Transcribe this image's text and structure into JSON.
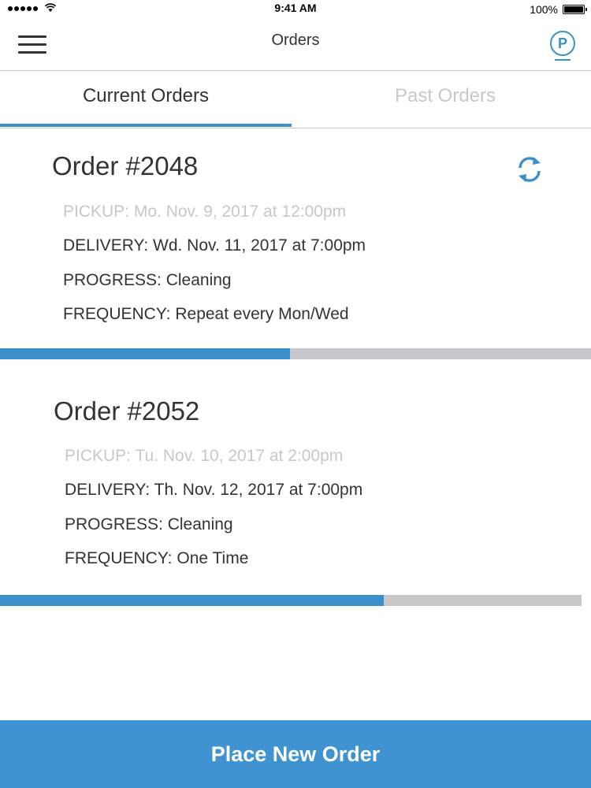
{
  "status_bar": {
    "time": "9:41 AM",
    "battery": "100%"
  },
  "nav": {
    "title": "Orders",
    "menu_icon": "hamburger-menu-icon",
    "profile_icon": "profile-p-icon",
    "profile_letter": "P"
  },
  "tabs": [
    {
      "label": "Current Orders",
      "active": true
    },
    {
      "label": "Past Orders",
      "active": false
    }
  ],
  "orders": [
    {
      "title": "Order #2048",
      "pickup": "PICKUP: Mo. Nov. 9, 2017 at 12:00pm",
      "delivery": "DELIVERY: Wd. Nov. 11, 2017 at 7:00pm",
      "progress": "PROGRESS: Cleaning",
      "frequency": "FREQUENCY: Repeat every Mon/Wed",
      "progress_fraction": 0.49,
      "has_repeat_icon": true
    },
    {
      "title": "Order #2052",
      "pickup": "PICKUP: Tu. Nov. 10, 2017 at 2:00pm",
      "delivery": "DELIVERY: Th. Nov. 12, 2017 at 7:00pm",
      "progress": "PROGRESS: Cleaning",
      "frequency": "FREQUENCY: One Time",
      "progress_fraction": 0.66,
      "has_repeat_icon": false
    }
  ],
  "place_order_label": "Place New Order",
  "colors": {
    "accent": "#3b8fcb",
    "button": "#3e93d0",
    "muted": "#c8c8cc",
    "text": "#333333"
  }
}
